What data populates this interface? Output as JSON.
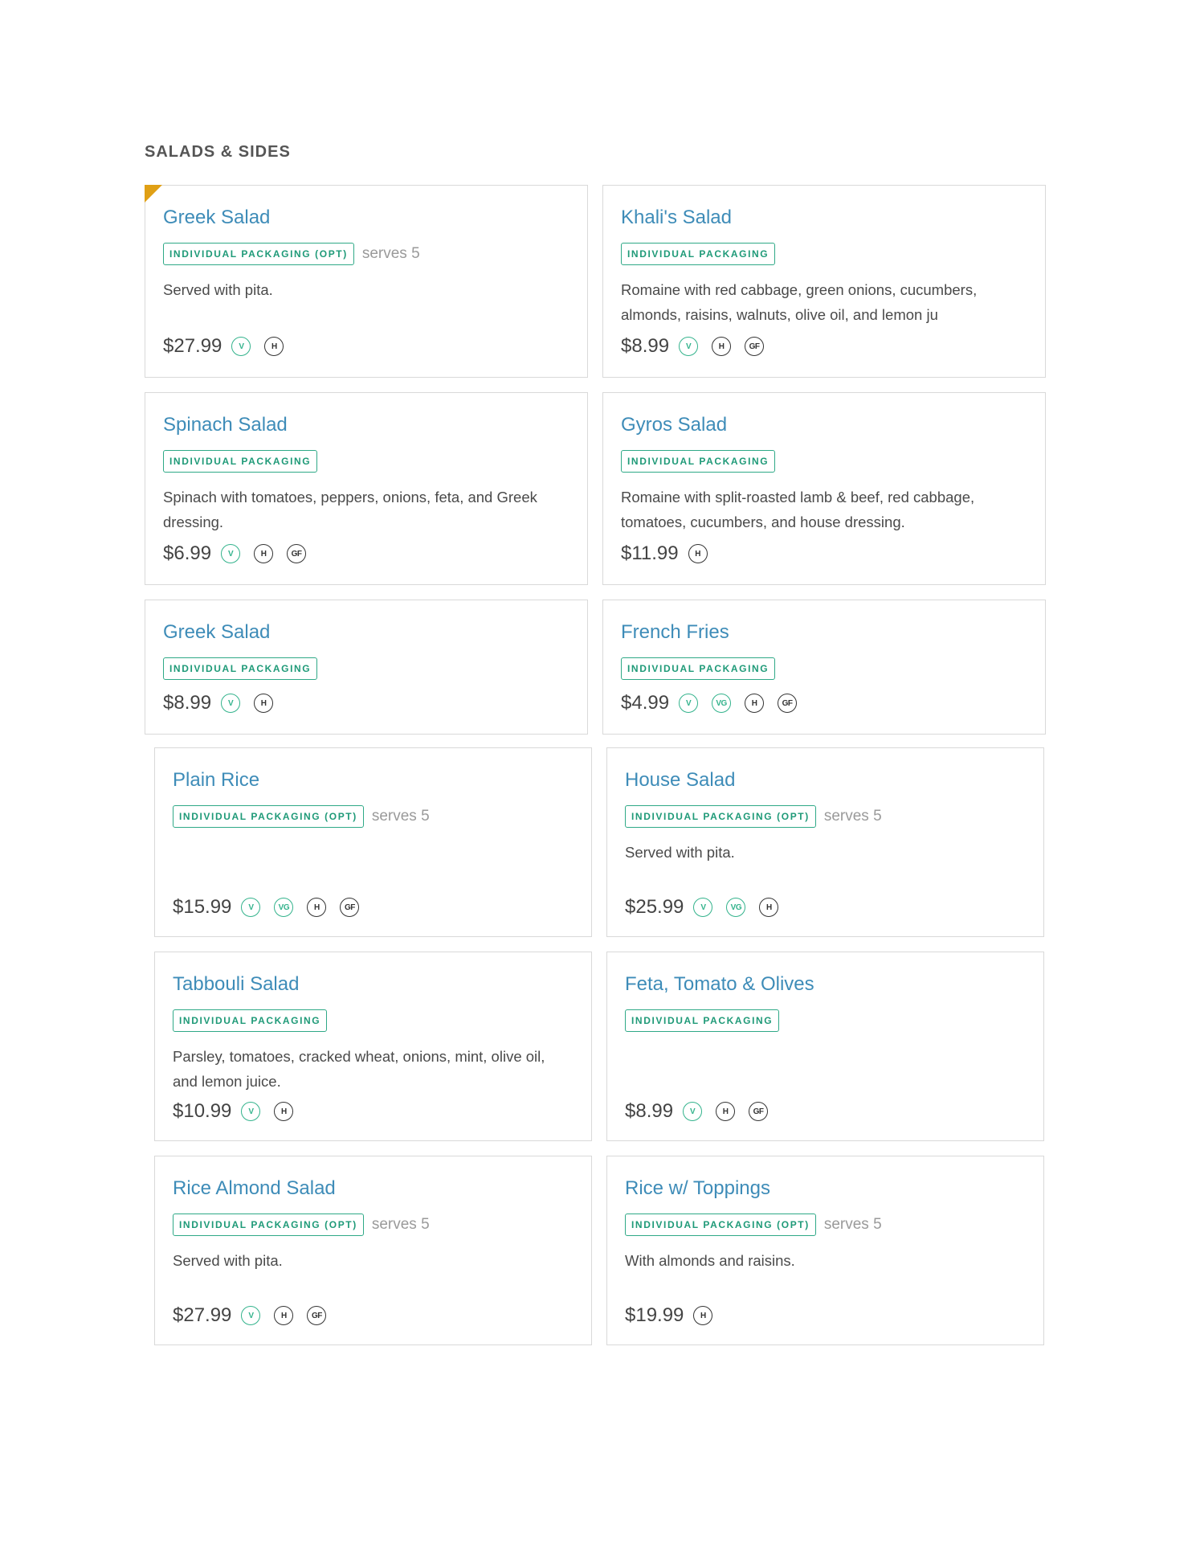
{
  "section": {
    "title": "SALADS & SIDES"
  },
  "items": [
    {
      "name": "Greek Salad",
      "tag": "INDIVIDUAL PACKAGING (OPT)",
      "serves": "serves 5",
      "description": "Served with pita.",
      "price": "$27.99",
      "badges": [
        "V",
        "H"
      ]
    },
    {
      "name": "Khali's Salad",
      "tag": "INDIVIDUAL PACKAGING",
      "serves": "",
      "description": "Romaine with red cabbage, green onions, cucumbers, almonds, raisins, walnuts, olive oil, and lemon ju",
      "price": "$8.99",
      "badges": [
        "V",
        "H",
        "GF"
      ]
    },
    {
      "name": "Spinach Salad",
      "tag": "INDIVIDUAL PACKAGING",
      "serves": "",
      "description": "Spinach with tomatoes, peppers, onions, feta, and Greek dressing.",
      "price": "$6.99",
      "badges": [
        "V",
        "H",
        "GF"
      ]
    },
    {
      "name": "Gyros Salad",
      "tag": "INDIVIDUAL PACKAGING",
      "serves": "",
      "description": "Romaine with split-roasted lamb & beef, red cabbage, tomatoes, cucumbers, and house dressing.",
      "price": "$11.99",
      "badges": [
        "H"
      ]
    },
    {
      "name": "Greek Salad",
      "tag": "INDIVIDUAL PACKAGING",
      "serves": "",
      "description": "",
      "price": "$8.99",
      "badges": [
        "V",
        "H"
      ]
    },
    {
      "name": "French Fries",
      "tag": "INDIVIDUAL PACKAGING",
      "serves": "",
      "description": "",
      "price": "$4.99",
      "badges": [
        "V",
        "VG",
        "H",
        "GF"
      ]
    },
    {
      "name": "Plain Rice",
      "tag": "INDIVIDUAL PACKAGING (OPT)",
      "serves": "serves 5",
      "description": "",
      "price": "$15.99",
      "badges": [
        "V",
        "VG",
        "H",
        "GF"
      ]
    },
    {
      "name": "House Salad",
      "tag": "INDIVIDUAL PACKAGING (OPT)",
      "serves": "serves 5",
      "description": "Served with pita.",
      "price": "$25.99",
      "badges": [
        "V",
        "VG",
        "H"
      ]
    },
    {
      "name": "Tabbouli Salad",
      "tag": "INDIVIDUAL PACKAGING",
      "serves": "",
      "description": "Parsley, tomatoes, cracked wheat, onions, mint, olive oil, and lemon juice.",
      "price": "$10.99",
      "badges": [
        "V",
        "H"
      ]
    },
    {
      "name": "Feta, Tomato & Olives",
      "tag": "INDIVIDUAL PACKAGING",
      "serves": "",
      "description": "",
      "price": "$8.99",
      "badges": [
        "V",
        "H",
        "GF"
      ]
    },
    {
      "name": "Rice Almond Salad",
      "tag": "INDIVIDUAL PACKAGING (OPT)",
      "serves": "serves 5",
      "description": "Served with pita.",
      "price": "$27.99",
      "badges": [
        "V",
        "H",
        "GF"
      ]
    },
    {
      "name": "Rice w/ Toppings",
      "tag": "INDIVIDUAL PACKAGING (OPT)",
      "serves": "serves 5",
      "description": "With almonds and raisins.",
      "price": "$19.99",
      "badges": [
        "H"
      ]
    }
  ]
}
